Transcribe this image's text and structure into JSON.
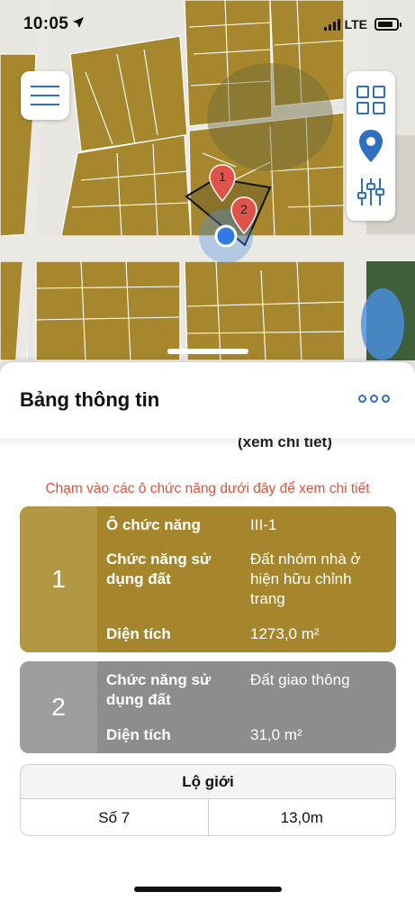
{
  "status_bar": {
    "time": "10:05",
    "network": "LTE"
  },
  "map": {
    "colors": {
      "parcel": "#a6872d",
      "road": "#e8e6e0",
      "green": "#3f5f3b",
      "water": "#4a90e2",
      "accent": "#2f6fc2",
      "marker": "#e0534a"
    },
    "markers": [
      {
        "label": "1"
      },
      {
        "label": "2"
      }
    ],
    "icons": [
      "menu-icon",
      "grid-icon",
      "location-pin-icon",
      "sliders-icon"
    ]
  },
  "sheet": {
    "title": "Bảng thông tin",
    "more_icon": "more-icon",
    "cut_text": "(xem chi tiết)",
    "hint": "Chạm vào các ô chức năng dưới đây để xem chi tiết",
    "cards": [
      {
        "number": "1",
        "color": "#a6862c",
        "rows": [
          {
            "key": "Ô chức năng",
            "value": "III-1"
          },
          {
            "key": "Chức năng sử dụng đất",
            "value": "Đất nhóm nhà ở hiện hữu chỉnh trang"
          },
          {
            "key": "Diện tích",
            "value": "1273,0 m²"
          }
        ]
      },
      {
        "number": "2",
        "color": "#8d8d8d",
        "rows": [
          {
            "key": "Chức năng sử dụng đất",
            "value": "Đất giao thông"
          },
          {
            "key": "Diện tích",
            "value": "31,0 m²"
          }
        ]
      }
    ],
    "lo_gioi": {
      "header": "Lộ giới",
      "rows": [
        {
          "name": "Số 7",
          "width": "13,0m"
        }
      ]
    }
  }
}
